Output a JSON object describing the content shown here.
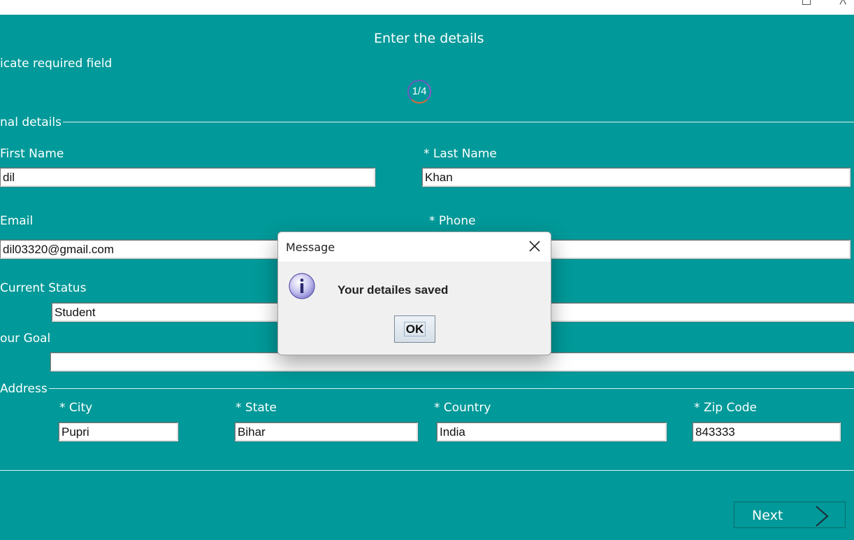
{
  "page": {
    "heading": "Enter the details",
    "required_note": "icate required field",
    "step": "1/4"
  },
  "personal": {
    "legend": "nal details",
    "first_name": {
      "label": "First Name",
      "value": "dil"
    },
    "last_name": {
      "label": "* Last Name",
      "value": "Khan"
    },
    "email": {
      "label": "Email",
      "value": "dil03320@gmail.com"
    },
    "phone": {
      "label": "* Phone",
      "value": ""
    },
    "status": {
      "label": "Current Status",
      "value": "Student"
    },
    "goal": {
      "label": "our Goal",
      "value": ""
    }
  },
  "address": {
    "legend": "Address",
    "city": {
      "label": "* City",
      "value": "Pupri"
    },
    "state": {
      "label": "* State",
      "value": "Bihar"
    },
    "country": {
      "label": "* Country",
      "value": "India"
    },
    "zip": {
      "label": "* Zip Code",
      "value": "843333"
    }
  },
  "nav": {
    "next_label": "Next"
  },
  "dialog": {
    "title": "Message",
    "message": "Your detailes saved",
    "ok_label": "OK",
    "icon": "info-icon"
  },
  "colors": {
    "background": "#019999",
    "dialog_bg": "#f0f0f0"
  }
}
